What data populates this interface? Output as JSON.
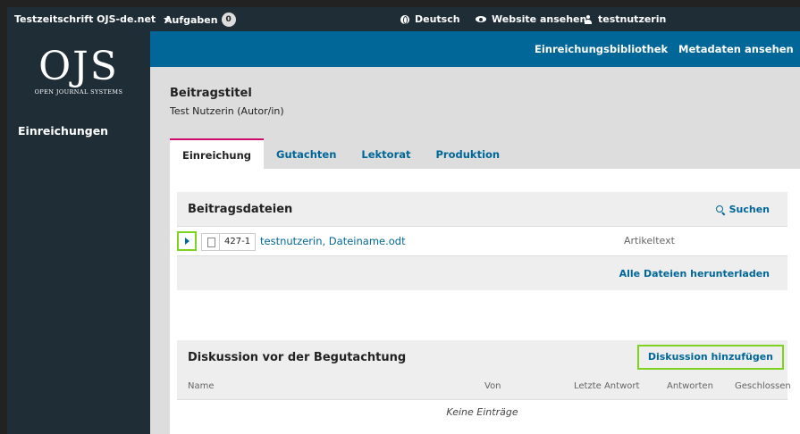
{
  "topbar": {
    "journal": "Testzeitschrift OJS-de.net",
    "tasks_label": "Aufgaben",
    "tasks_count": "0",
    "language": "Deutsch",
    "view_site": "Website ansehen",
    "user": "testnutzerin"
  },
  "sidebar": {
    "logo_big": "OJS",
    "logo_small": "OPEN JOURNAL SYSTEMS",
    "items": [
      {
        "label": "Einreichungen"
      }
    ]
  },
  "bluebar": {
    "library": "Einreichungsbibliothek",
    "metadata": "Metadaten ansehen"
  },
  "submission": {
    "title": "Beitragstitel",
    "author": "Test Nutzerin (Autor/in)"
  },
  "tabs": [
    {
      "label": "Einreichung",
      "active": true
    },
    {
      "label": "Gutachten"
    },
    {
      "label": "Lektorat"
    },
    {
      "label": "Produktion"
    }
  ],
  "files_panel": {
    "title": "Beitragsdateien",
    "search": "Suchen",
    "file": {
      "id": "427-1",
      "name": "testnutzerin, Dateiname.odt",
      "type": "Artikeltext"
    },
    "download_all": "Alle Dateien herunterladen"
  },
  "discussion_panel": {
    "title": "Diskussion vor der Begutachtung",
    "add_button": "Diskussion hinzufügen",
    "columns": [
      "Name",
      "Von",
      "Letzte Antwort",
      "Antworten",
      "Geschlossen"
    ],
    "empty": "Keine Einträge"
  },
  "colors": {
    "header_dark": "#1f2d37",
    "primary_blue": "#006798",
    "active_tab_accent": "#d00a6c",
    "highlight_green": "#7ed321"
  }
}
